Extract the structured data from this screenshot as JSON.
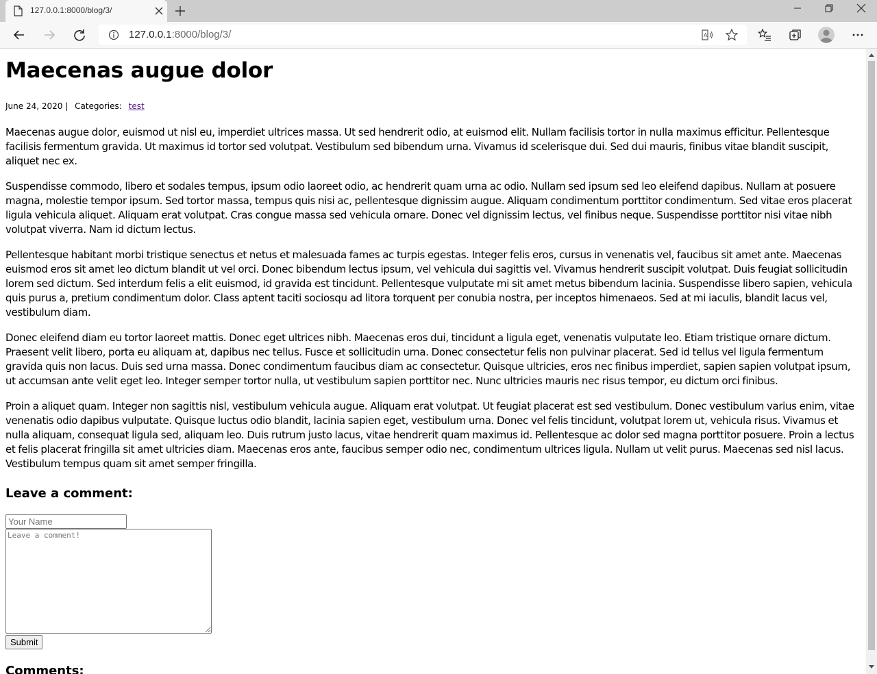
{
  "browser": {
    "tab_title": "127.0.0.1:8000/blog/3/",
    "url_host": "127.0.0.1",
    "url_rest": ":8000/blog/3/"
  },
  "post": {
    "title": "Maecenas augue dolor",
    "date": "June 24, 2020 |",
    "categories_label": "Categories:",
    "category": "test",
    "paragraphs": [
      "Maecenas augue dolor, euismod ut nisl eu, imperdiet ultrices massa. Ut sed hendrerit odio, at euismod elit. Nullam facilisis tortor in nulla maximus efficitur. Pellentesque facilisis fermentum gravida. Ut maximus id tortor sed volutpat. Vestibulum sed bibendum urna. Vivamus id scelerisque dui. Sed dui mauris, finibus vitae blandit suscipit, aliquet nec ex.",
      "Suspendisse commodo, libero et sodales tempus, ipsum odio laoreet odio, ac hendrerit quam urna ac odio. Nullam sed ipsum sed leo eleifend dapibus. Nullam at posuere magna, molestie tempor ipsum. Sed tortor massa, tempus quis nisi ac, pellentesque dignissim augue. Aliquam condimentum porttitor condimentum. Sed vitae eros placerat ligula vehicula aliquet. Aliquam erat volutpat. Cras congue massa sed vehicula ornare. Donec vel dignissim lectus, vel finibus neque. Suspendisse porttitor nisi vitae nibh volutpat viverra. Nam id dictum lectus.",
      "Pellentesque habitant morbi tristique senectus et netus et malesuada fames ac turpis egestas. Integer felis eros, cursus in venenatis vel, faucibus sit amet ante. Maecenas euismod eros sit amet leo dictum blandit ut vel orci. Donec bibendum lectus ipsum, vel vehicula dui sagittis vel. Vivamus hendrerit suscipit volutpat. Duis feugiat sollicitudin lorem sed dictum. Sed interdum felis a elit euismod, id gravida est tincidunt. Pellentesque vulputate mi sit amet metus bibendum lacinia. Suspendisse libero sapien, vehicula quis purus a, pretium condimentum dolor. Class aptent taciti sociosqu ad litora torquent per conubia nostra, per inceptos himenaeos. Sed at mi iaculis, blandit lacus vel, vestibulum diam.",
      "Donec eleifend diam eu tortor laoreet mattis. Donec eget ultrices nibh. Maecenas eros dui, tincidunt a ligula eget, venenatis vulputate leo. Etiam tristique ornare dictum. Praesent velit libero, porta eu aliquam at, dapibus nec tellus. Fusce et sollicitudin urna. Donec consectetur felis non pulvinar placerat. Sed id tellus vel ligula fermentum gravida quis non lacus. Duis sed urna massa. Donec condimentum faucibus diam ac consectetur. Quisque ultricies, eros nec finibus imperdiet, sapien sapien volutpat ipsum, ut accumsan ante velit eget leo. Integer semper tortor nulla, ut vestibulum sapien porttitor nec. Nunc ultricies mauris nec risus tempor, eu dictum orci finibus.",
      "Proin a aliquet quam. Integer non sagittis nisl, vestibulum vehicula augue. Aliquam erat volutpat. Ut feugiat placerat est sed vestibulum. Donec vestibulum varius enim, vitae venenatis odio dapibus vulputate. Quisque luctus odio blandit, lacinia sapien eget, vestibulum urna. Donec vel felis tincidunt, volutpat lorem ut, vehicula risus. Vivamus et nulla aliquam, consequat ligula sed, aliquam leo. Duis rutrum justo lacus, vitae hendrerit quam maximus id. Pellentesque ac dolor sed magna porttitor posuere. Proin a lectus et felis placerat fringilla sit amet ultricies diam. Maecenas eros ante, faucibus semper odio nec, condimentum ultrices ligula. Nullam ut velit purus. Maecenas sed nisl lacus. Vestibulum tempus quam sit amet semper fringilla."
    ]
  },
  "comment_form": {
    "heading": "Leave a comment:",
    "name_placeholder": "Your Name",
    "name_value": "",
    "comment_placeholder": "Leave a comment!",
    "comment_value": "",
    "submit_label": "Submit"
  },
  "comments": {
    "heading": "Comments:"
  },
  "icons": {
    "page": "page-icon",
    "close": "close-icon",
    "new_tab": "plus-icon",
    "back": "back-arrow-icon",
    "forward": "forward-arrow-icon",
    "refresh": "refresh-icon",
    "info": "info-icon",
    "read_aloud": "read-aloud-icon",
    "favorite": "star-icon",
    "favorites": "favorites-list-icon",
    "collections": "collections-icon",
    "profile": "profile-avatar",
    "menu": "more-options-icon"
  },
  "colors": {
    "link_visited": "#551a8b",
    "tabstrip": "#cdcdcd",
    "toolbar": "#f7f7f7"
  }
}
